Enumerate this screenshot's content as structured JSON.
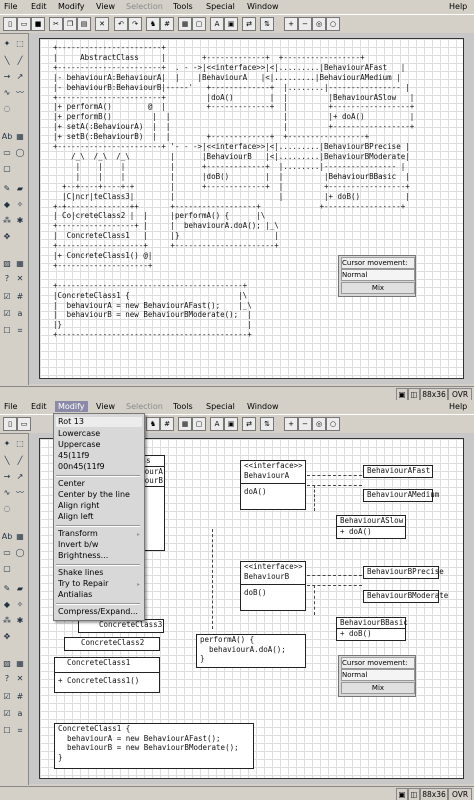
{
  "menubar": {
    "items": [
      "File",
      "Edit",
      "Modify",
      "View",
      "Selection",
      "Tools",
      "Special",
      "Window"
    ],
    "help": "Help"
  },
  "toolbar": {
    "icons": [
      "new-icon",
      "open-icon",
      "save-icon",
      "cut-icon",
      "copy-icon",
      "paste-icon",
      "delete-icon",
      "undo-icon",
      "redo-icon",
      "camel-icon",
      "grid-icon",
      "fill-icon",
      "outline-icon",
      "text-frame-icon",
      "flip-icon",
      "zoom-in-icon",
      "zoom-out-icon",
      "zoom-fit-icon",
      "zoom-reset-icon"
    ]
  },
  "status": {
    "size": "88x36",
    "mode": "OVR"
  },
  "cursor_panel": {
    "title": "Cursor movement:",
    "selected": "Normal",
    "mix": "Mix"
  },
  "ascii_art": "  +-----------------------+\n  |     AbstractClass     |        +-------------+  +-----------------+\n  +-----------------------+  . - ->|<<interface>>|<|.........|BehaviourAFast   |\n  |- behaviourA:BehaviourA|  |    |BehaviourA   |<|.........|BehaviourAMedium |\n  |- behaviourB:BehaviourB|-----'   +-------------+  |........|---------------- |\n  +-----------------------+         |doA()        |  |         |BehaviourASlow   |\n  |+ performA()        @  |         +-------------+  |         +-----------------+\n  |+ performB()         |  |                         |         |+ doA()          |\n  |+ setA(:BehaviourA)  |  |                         |         +-----------------+\n  |+ setB(:BehaviourB)  |  |        +-------------+  +-----------------+\n  +-----------------------+ '- - ->|<<interface>>|<|.........|BehaviourBPrecise |\n      /_\\  /_\\  /_\\         |      |BehaviourB   |<|.........|BehaviourBModerate|\n       |    |    |          |      +-------------+  |........|---------------- |\n       |    |    |          |      |doB()        |  |         |BehaviourBBasic  |\n    +--+----+----+-+        |      +-------------+  |         +-----------------+\n    |C|ncr|teClass3|        |                       |         |+ doB()          |\n  +-+--------------++       +------------------+             +-----------------+\n  | Co|creteClass2 |  |     |performA() {      |\\\n  +-----------------+ |     |  behaviourA.doA(); |_\\\n  |  ConcreteClass1   |     |}                     |\n  +-------------------+     +----------------------+\n  |+ ConcreteClass1() @|\n  +--------------------+\n\n  +-----------------------------------------+\n  |ConcreteClass1 {                        |\\\n  |  behaviourA = new BehaviourAFast();    |_\\\n  |  behaviourB = new BehaviourBModerate();  |\n  |}                                         |\n  +------------------------------------------+",
  "diagram": {
    "abstract_class": {
      "name": "AbstractClass",
      "attrs": [
        "- behaviourA:BehaviourA",
        "- behaviourB:BehaviourB"
      ],
      "ops": [
        "+ performA()",
        "+ performB()",
        "+ setA(:BehaviourA)",
        "+ setB(:BehaviourB)"
      ]
    },
    "interface_a": {
      "stereo": "<<interface>>",
      "name": "BehaviourA",
      "op": "doA()"
    },
    "interface_b": {
      "stereo": "<<interface>>",
      "name": "BehaviourB",
      "op": "doB()"
    },
    "impl_a": {
      "items": [
        "BehaviourAFast",
        "BehaviourAMedium",
        "BehaviourASlow"
      ],
      "op": "+ doA()"
    },
    "impl_b": {
      "items": [
        "BehaviourBPrecise",
        "BehaviourBModerate",
        "BehaviourBBasic"
      ],
      "op": "+ doB()"
    },
    "concrete": [
      "ConcreteClass3",
      "ConcreteClass2",
      "ConcreteClass1",
      "+ ConcreteClass1()"
    ],
    "note_perform": [
      "performA() {",
      "  behaviourA.doA();",
      "}"
    ],
    "note_ctor": [
      "ConcreteClass1 {",
      "  behaviourA = new BehaviourAFast();",
      "  behaviourB = new BehaviourBModerate();",
      "}"
    ]
  },
  "modify_menu": {
    "items": [
      "Rot 13",
      "Lowercase",
      "Uppercase",
      "45(11f9",
      "00n45(11f9",
      "Center",
      "Center by the line",
      "Align right",
      "Align left",
      "Transform",
      "Invert b/w",
      "Brightness...",
      "Shake lines",
      "Try to Repair",
      "Antialias",
      "Compress/Expand..."
    ]
  }
}
